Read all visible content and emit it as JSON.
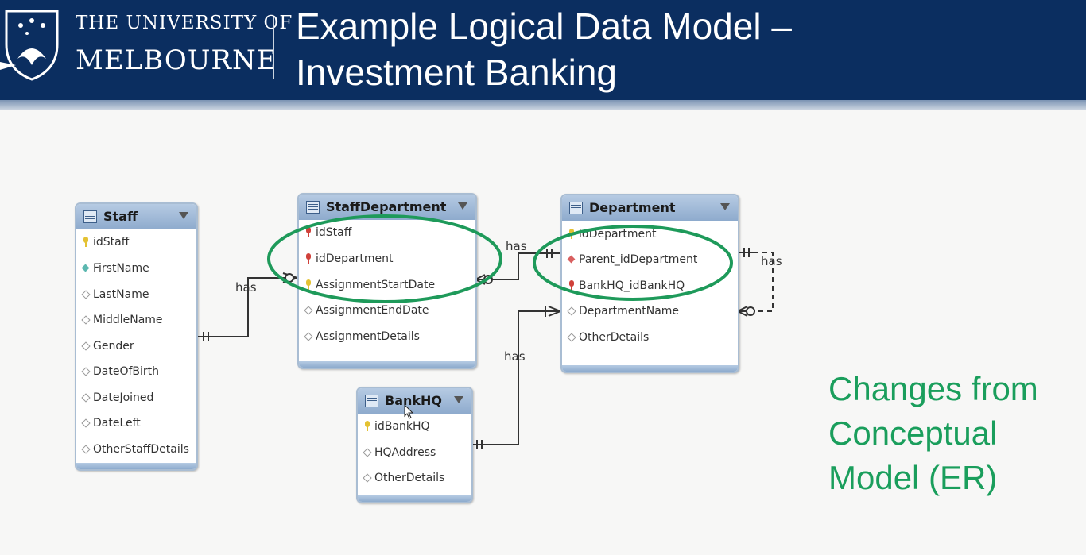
{
  "header": {
    "university_line1": "THE UNIVERSITY OF",
    "university_line2": "MELBOURNE",
    "title_line1": "Example Logical Data Model –",
    "title_line2": "Investment Banking",
    "background_color": "#0b2e60"
  },
  "entities": {
    "staff": {
      "name": "Staff",
      "attributes": [
        {
          "label": "idStaff",
          "icon": "primary-key-icon"
        },
        {
          "label": "FirstName",
          "icon": "not-null-attribute-icon"
        },
        {
          "label": "LastName",
          "icon": "attribute-icon"
        },
        {
          "label": "MiddleName",
          "icon": "attribute-icon"
        },
        {
          "label": "Gender",
          "icon": "attribute-icon"
        },
        {
          "label": "DateOfBirth",
          "icon": "attribute-icon"
        },
        {
          "label": "DateJoined",
          "icon": "attribute-icon"
        },
        {
          "label": "DateLeft",
          "icon": "attribute-icon"
        },
        {
          "label": "OtherStaffDetails",
          "icon": "attribute-icon"
        }
      ]
    },
    "staff_department": {
      "name": "StaffDepartment",
      "attributes": [
        {
          "label": "idStaff",
          "icon": "foreign-key-icon"
        },
        {
          "label": "idDepartment",
          "icon": "foreign-key-icon"
        },
        {
          "label": "AssignmentStartDate",
          "icon": "primary-key-icon"
        },
        {
          "label": "AssignmentEndDate",
          "icon": "attribute-icon"
        },
        {
          "label": "AssignmentDetails",
          "icon": "attribute-icon"
        }
      ]
    },
    "department": {
      "name": "Department",
      "attributes": [
        {
          "label": "idDepartment",
          "icon": "primary-key-icon"
        },
        {
          "label": "Parent_idDepartment",
          "icon": "foreign-key-attribute-icon"
        },
        {
          "label": "BankHQ_idBankHQ",
          "icon": "foreign-key-icon"
        },
        {
          "label": "DepartmentName",
          "icon": "attribute-icon"
        },
        {
          "label": "OtherDetails",
          "icon": "attribute-icon"
        }
      ]
    },
    "bankhq": {
      "name": "BankHQ",
      "attributes": [
        {
          "label": "idBankHQ",
          "icon": "primary-key-icon"
        },
        {
          "label": "HQAddress",
          "icon": "attribute-icon"
        },
        {
          "label": "OtherDetails",
          "icon": "attribute-icon"
        }
      ]
    }
  },
  "relationships": {
    "staff_to_staffdepartment": "has",
    "staffdepartment_to_department": "has",
    "bankhq_to_department": "has",
    "department_self": "has"
  },
  "annotation": {
    "line1": "Changes from",
    "line2": "Conceptual",
    "line3": "Model (ER)",
    "color": "#1a9e5c"
  },
  "highlight_color": "#1e9a5a"
}
